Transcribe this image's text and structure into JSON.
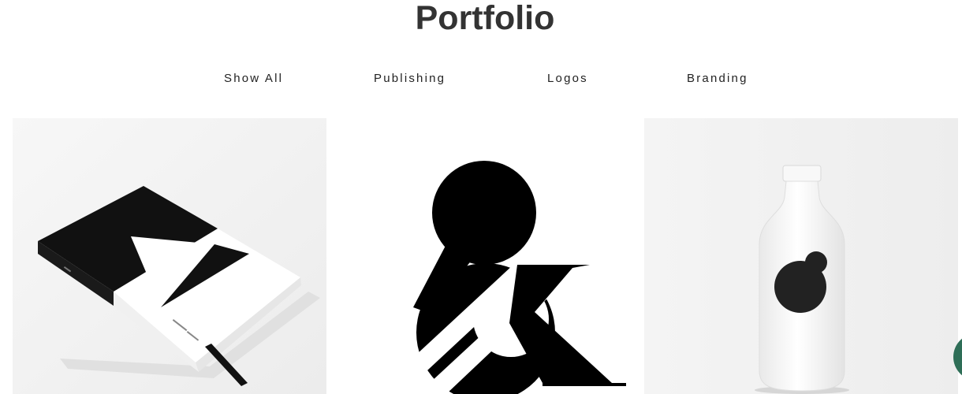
{
  "page": {
    "title": "Portfolio"
  },
  "filters": [
    {
      "label": "Show All"
    },
    {
      "label": "Publishing"
    },
    {
      "label": "Logos"
    },
    {
      "label": "Branding"
    }
  ],
  "portfolio_items": [
    {
      "name": "book-cover",
      "image": "book-icon"
    },
    {
      "name": "ampersand-logo",
      "image": "ampersand-icon"
    },
    {
      "name": "bottle-branding",
      "image": "bottle-icon"
    }
  ],
  "colors": {
    "title": "#333333",
    "filter_text": "#222222",
    "chat_bubble": "#2e6e57"
  }
}
